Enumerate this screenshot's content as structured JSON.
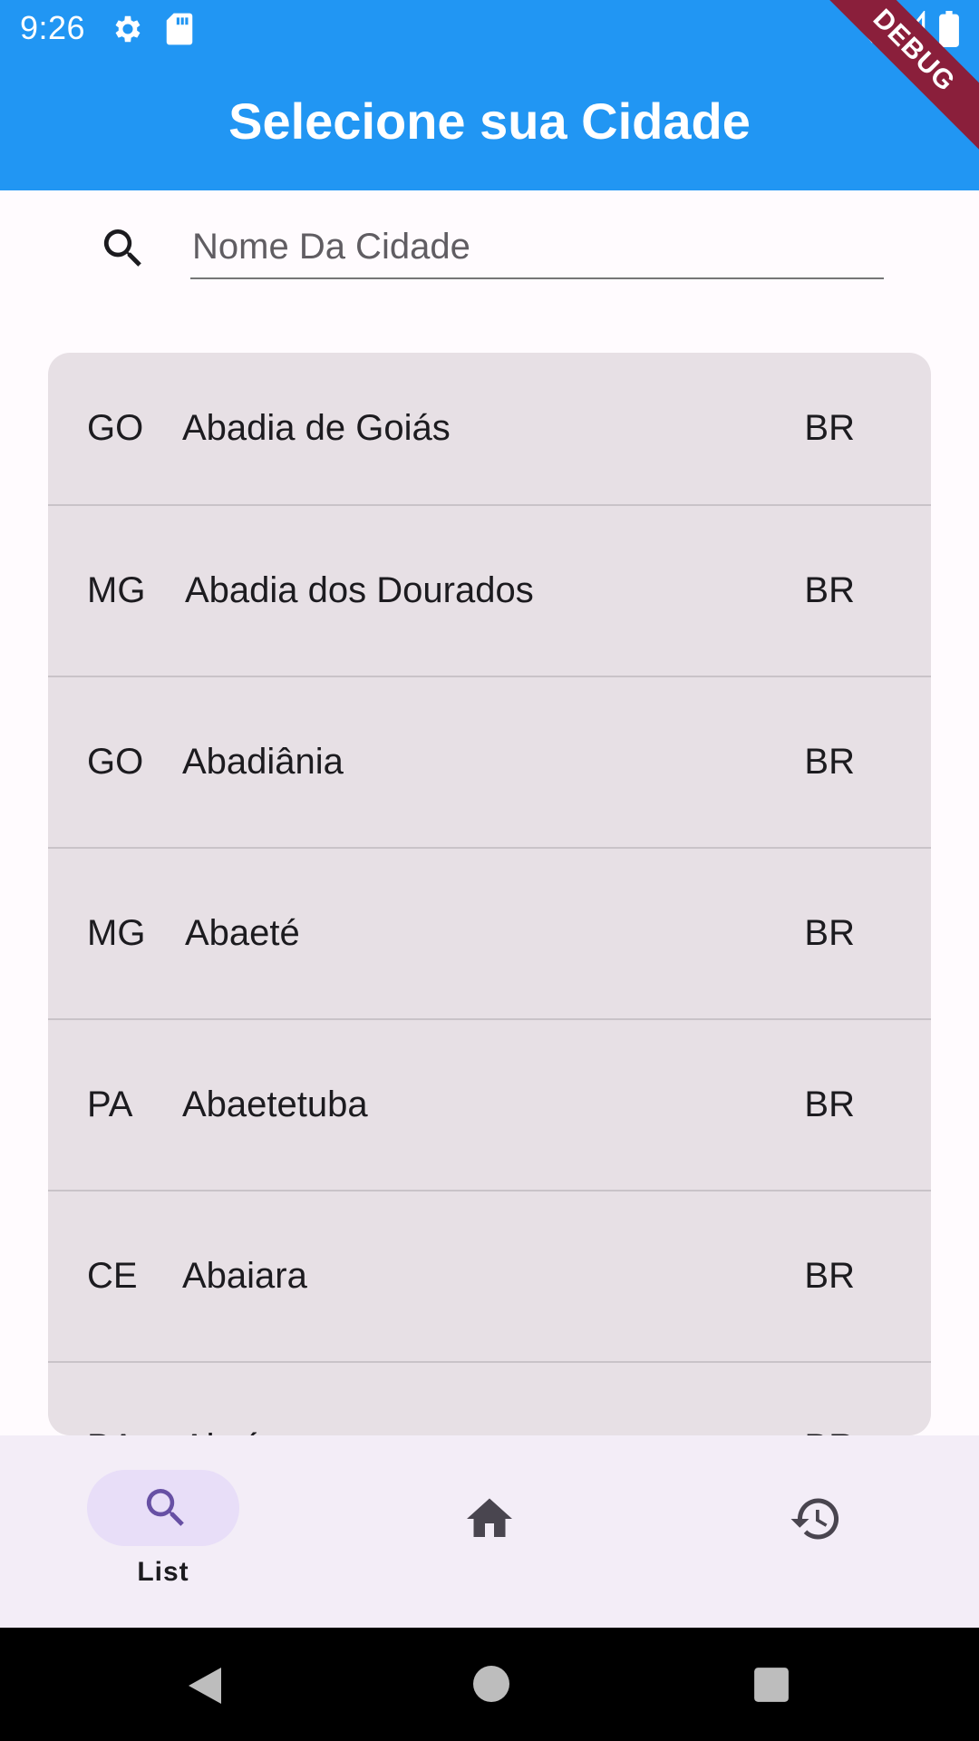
{
  "status_bar": {
    "time": "9:26",
    "icons": [
      "gear-icon",
      "sd-card-icon",
      "wifi-icon",
      "signal-icon",
      "battery-icon"
    ]
  },
  "debug_banner": "DEBUG",
  "app_bar": {
    "title": "Selecione sua Cidade",
    "color": "#2196f3"
  },
  "search": {
    "placeholder": "Nome Da Cidade",
    "value": ""
  },
  "cities": [
    {
      "state": "GO",
      "name": "Abadia de Goiás",
      "country": "BR"
    },
    {
      "state": "MG",
      "name": "Abadia dos Dourados",
      "country": "BR"
    },
    {
      "state": "GO",
      "name": "Abadiânia",
      "country": "BR"
    },
    {
      "state": "MG",
      "name": "Abaeté",
      "country": "BR"
    },
    {
      "state": "PA",
      "name": "Abaetetuba",
      "country": "BR"
    },
    {
      "state": "CE",
      "name": "Abaiara",
      "country": "BR"
    },
    {
      "state": "BA",
      "name": "Abaíra",
      "country": "BR"
    }
  ],
  "bottom_nav": {
    "items": [
      {
        "icon": "search-icon",
        "label": "List",
        "selected": true
      },
      {
        "icon": "home-icon",
        "label": "",
        "selected": false
      },
      {
        "icon": "history-icon",
        "label": "",
        "selected": false
      }
    ],
    "selected_color": "#e8def8",
    "accent": "#6750a4"
  },
  "system_nav": {
    "icons": [
      "back-icon",
      "home-circle-icon",
      "recents-icon"
    ]
  }
}
